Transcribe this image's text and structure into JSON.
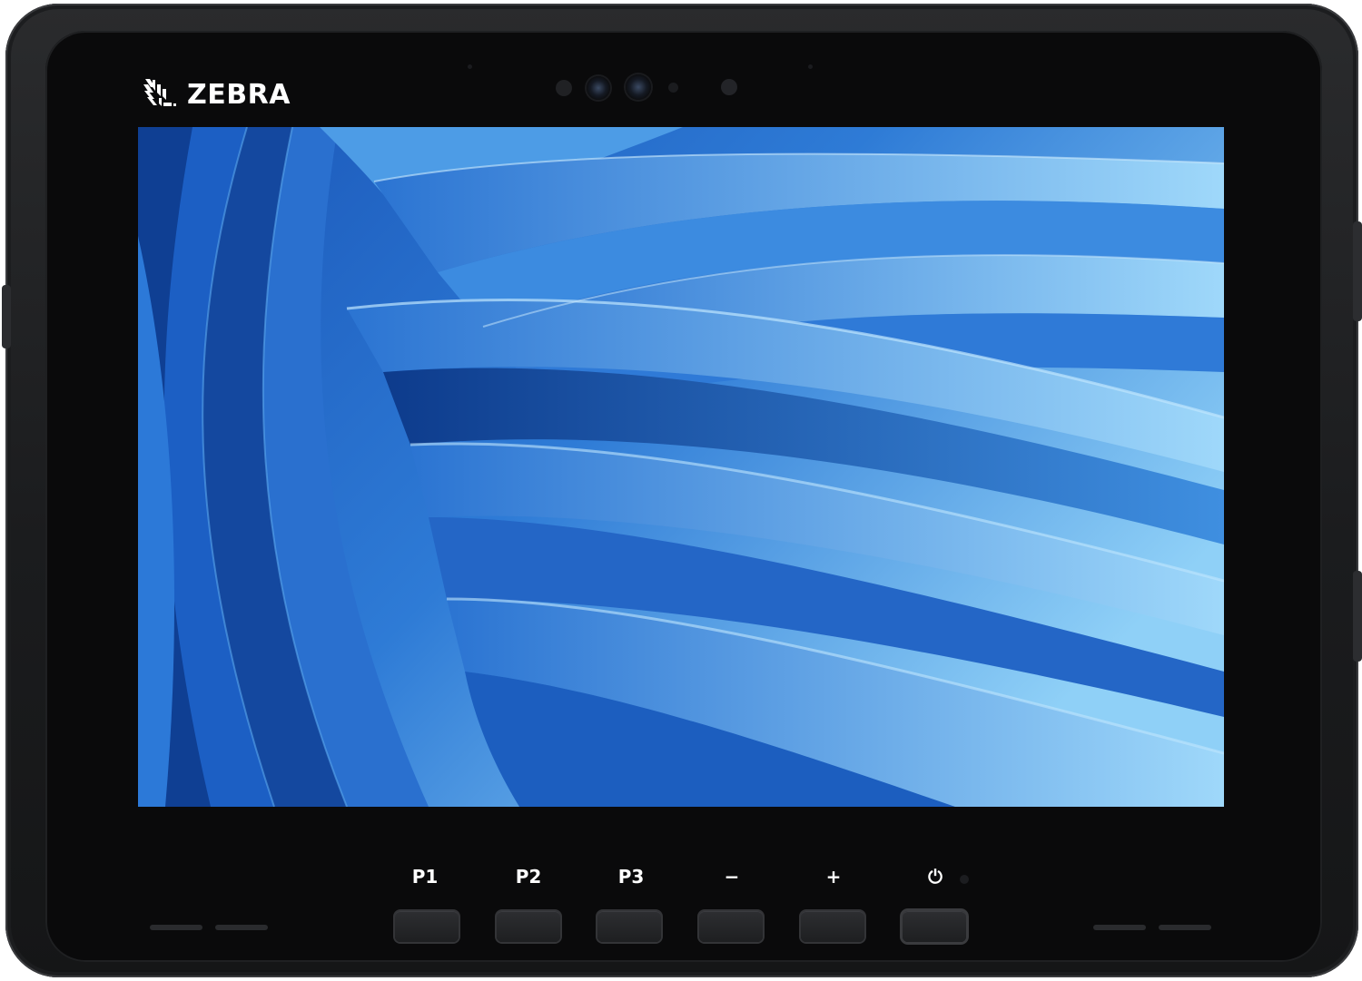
{
  "brand": {
    "name": "ZEBRA"
  },
  "keys": [
    {
      "id": "p1",
      "label": "P1"
    },
    {
      "id": "p2",
      "label": "P2"
    },
    {
      "id": "p3",
      "label": "P3"
    },
    {
      "id": "volume-down",
      "label": "−"
    },
    {
      "id": "volume-up",
      "label": "+"
    },
    {
      "id": "power",
      "label": "⏻"
    }
  ],
  "colors": {
    "body": "#1b1c1e",
    "bezel": "#0a0a0b",
    "wallpaper_dark": "#0f3f93",
    "wallpaper_light": "#7cc3f5"
  },
  "icons": {
    "brand_mark": "zebra-head-icon",
    "power": "power-icon"
  }
}
